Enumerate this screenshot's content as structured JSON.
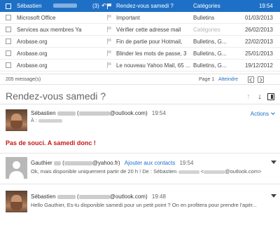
{
  "messages": [
    {
      "from": "Sébastien",
      "count": "(3)",
      "reply_icon": "reply-icon",
      "subject": "Rendez-vous samedi ?",
      "category": "Catégories",
      "date": "19:54"
    },
    {
      "from": "Microsoft Office",
      "subject": "Important",
      "category": "Bulletins",
      "date": "01/03/2013"
    },
    {
      "from": "Services aux membres Ya",
      "subject": "Vérifier cette adresse mail",
      "category": "Catégories",
      "date": "26/02/2013"
    },
    {
      "from": "Arobase.org",
      "subject": "Fin de partie pour Hotmail,",
      "category": "Bulletins, G...",
      "date": "22/02/2013"
    },
    {
      "from": "Arobase.org",
      "subject": "Blinder les mots de passe, 3",
      "category": "Bulletins, G...",
      "date": "25/01/2013"
    },
    {
      "from": "Arobase.org",
      "subject": "Le nouveau Yahoo Mail, 65 ...",
      "category": "Bulletins, G...",
      "date": "19/12/2012"
    }
  ],
  "pager": {
    "count_label": "205 message(s)",
    "page_label": "Page 1",
    "goto_label": "Atteindre"
  },
  "conversation": {
    "title": "Rendez-vous samedi ?",
    "actions_label": "Actions",
    "first": {
      "name": "Sébastien",
      "email_domain": "@outlook.com)",
      "time": "19:54",
      "to_label": "À :",
      "body": "Pas de souci. A samedi donc !"
    },
    "second": {
      "name": "Gauthier",
      "email_domain": "@yahoo.fr)",
      "add_contact": "Ajouter aux contacts",
      "time": "19:54",
      "snippet": "Ok, mais disponible uniquement partir de 20 h ! De : Sébastien",
      "snippet_tail": "@outlook.com>"
    },
    "third": {
      "name": "Sébastien",
      "email_domain": "@outlook.com)",
      "time": "19:48",
      "snippet": "Hello Gauthier, Es-tu disponible samedi pour un petit point ? On en profitera pour prendre l'apér..."
    }
  },
  "colors": {
    "accent": "#1e70c6",
    "alert_text": "#c41919"
  }
}
